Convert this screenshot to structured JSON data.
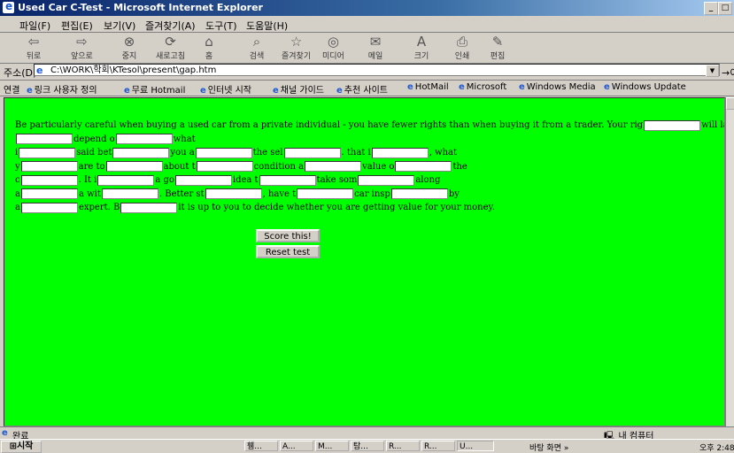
{
  "window": {
    "title": "Used Car C-Test - Microsoft Internet Explorer"
  },
  "menu": [
    "파일(F)",
    "편집(E)",
    "보기(V)",
    "즐겨찾기(A)",
    "도구(T)",
    "도움말(H)"
  ],
  "toolbar": {
    "back": "뒤로",
    "forward": "앞으로",
    "stop": "중지",
    "refresh": "새로고침",
    "home": "홈",
    "search": "검색",
    "favorites": "즐겨찾기",
    "media": "미디어",
    "mail": "메일",
    "size": "크기",
    "print": "인쇄",
    "edit": "편집"
  },
  "address": {
    "label": "주소(D)",
    "url": "C:\\WORK\\학회\\KTesol\\present\\gap.htm",
    "go": "이동"
  },
  "links": {
    "label": "연결",
    "items": [
      "링크 사용자 정의",
      "무료 Hotmail",
      "인터넷 시작",
      "채널 가이드",
      "추천 사이트",
      "HotMail",
      "Microsoft",
      "Windows Media",
      "Windows Update"
    ]
  },
  "passage": {
    "l1": [
      "Be particularly careful when buying a used car from a private individual - you have fewer rights than when buying it from a trader. Your rig",
      "will lar"
    ],
    "l2": [
      "",
      "depend o",
      "what"
    ],
    "l3": [
      "i",
      "said bet",
      "you a",
      "the sel",
      ". that i",
      ", what"
    ],
    "l4": [
      "y",
      "are to",
      "about t",
      "condition a",
      "value o",
      "the"
    ],
    "l5": [
      "c",
      ". It i",
      "a go",
      "idea t",
      "take som",
      "along"
    ],
    "l6": [
      "a",
      "a wit",
      ". Better st",
      ", have t",
      "car insp",
      "by"
    ],
    "l7": [
      "a",
      "expert. B",
      "it is up to you to decide whether you are getting value for your money."
    ]
  },
  "buttons": {
    "score": "Score this!",
    "reset": "Reset test"
  },
  "status": {
    "text": "완료",
    "zone": "내 컴퓨터"
  },
  "taskbar": {
    "start": "시작",
    "tasks": [
      "휌...",
      "A...",
      "M...",
      "탐...",
      "R...",
      "R...",
      "U..."
    ],
    "tray": "바탕 화면 »",
    "clock": "오후 2:48"
  }
}
